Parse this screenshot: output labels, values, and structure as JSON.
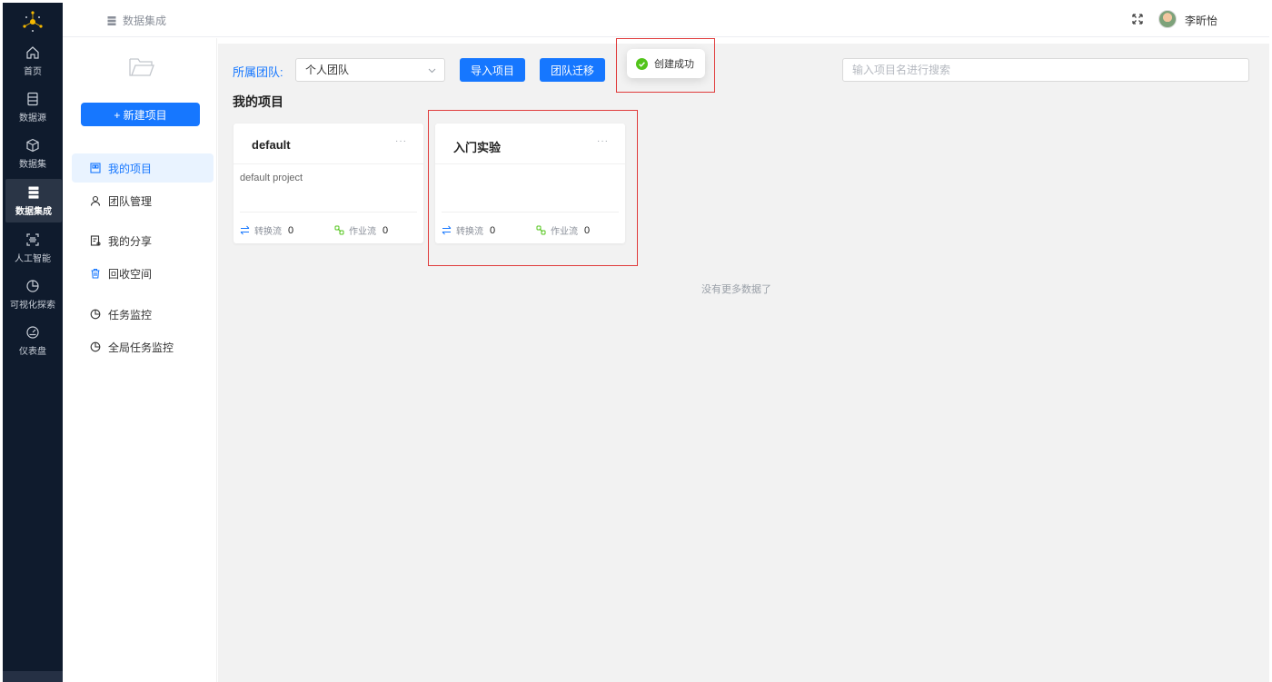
{
  "nav": {
    "items": [
      {
        "label": "首页",
        "icon": "home-icon"
      },
      {
        "label": "数据源",
        "icon": "database-icon"
      },
      {
        "label": "数据集",
        "icon": "cube-icon"
      },
      {
        "label": "数据集成",
        "icon": "server-icon",
        "active": true
      },
      {
        "label": "人工智能",
        "icon": "scan-icon"
      },
      {
        "label": "可视化探索",
        "icon": "pie-icon"
      },
      {
        "label": "仪表盘",
        "icon": "gauge-icon"
      }
    ]
  },
  "header": {
    "breadcrumb": "数据集成",
    "username": "李昕怡"
  },
  "sidebar": {
    "new_button": "+ 新建项目",
    "items": [
      {
        "label": "我的项目",
        "icon": "project-icon",
        "active": true
      },
      {
        "label": "团队管理",
        "icon": "user-icon"
      },
      {
        "label": "我的分享",
        "icon": "share-doc-icon"
      },
      {
        "label": "回收空间",
        "icon": "trash-icon"
      },
      {
        "label": "任务监控",
        "icon": "monitor-pie-icon"
      },
      {
        "label": "全局任务监控",
        "icon": "monitor-pie-icon"
      }
    ]
  },
  "main": {
    "team_label": "所属团队:",
    "team_value": "个人团队",
    "import_button": "导入项目",
    "migrate_button": "团队迁移",
    "search_placeholder": "输入项目名进行搜索",
    "section_title": "我的项目",
    "no_more": "没有更多数据了",
    "projects": [
      {
        "name": "default",
        "description": "default project",
        "transform_label": "转换流",
        "transform_count": "0",
        "job_label": "作业流",
        "job_count": "0"
      },
      {
        "name": "入门实验",
        "description": "",
        "transform_label": "转换流",
        "transform_count": "0",
        "job_label": "作业流",
        "job_count": "0"
      }
    ]
  },
  "toast": {
    "message": "创建成功",
    "status_color": "#52c41a"
  },
  "colors": {
    "accent": "#1677ff",
    "nav_bg": "#0f1b2d",
    "highlight_box": "#e03c3c"
  }
}
